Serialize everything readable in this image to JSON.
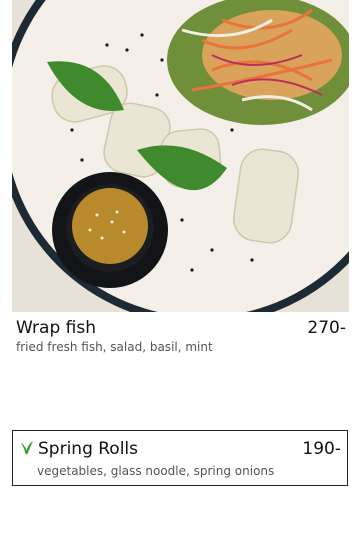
{
  "dishes": [
    {
      "name": "Wrap fish",
      "price": "270-",
      "description": "fried fresh fish, salad, basil, mint"
    },
    {
      "name": "Spring Rolls",
      "price": "190-",
      "description": "vegetables, glass noodle, spring onions",
      "icon": "vegan-leaf-icon"
    }
  ],
  "colors": {
    "leaf": "#3a9a3a",
    "plate_rim": "#1b2730",
    "text": "#111111",
    "muted": "#555555"
  }
}
